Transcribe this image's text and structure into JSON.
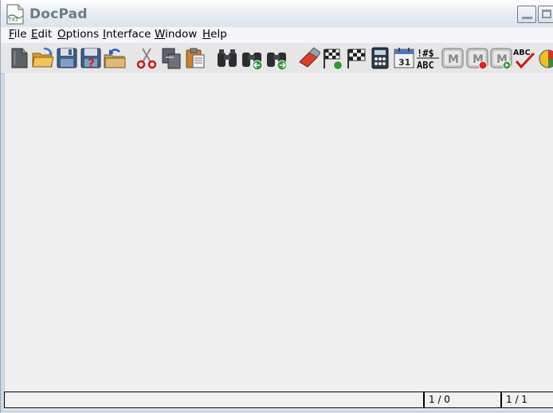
{
  "window": {
    "title": "DocPad"
  },
  "menu": [
    {
      "mnemonic": "F",
      "rest": "ile"
    },
    {
      "mnemonic": "E",
      "rest": "dit"
    },
    {
      "mnemonic": "O",
      "rest": "ptions"
    },
    {
      "mnemonic": "I",
      "rest": "nterface"
    },
    {
      "mnemonic": "W",
      "rest": "indow"
    },
    {
      "mnemonic": "H",
      "rest": "elp"
    }
  ],
  "toolbar": {
    "icons": [
      "new-document-icon",
      "open-folder-icon",
      "save-icon",
      "save-as-icon",
      "reload-icon",
      "cut-icon",
      "copy-icon",
      "paste-icon",
      "find-icon",
      "find-previous-icon",
      "find-next-icon",
      "eraser-icon",
      "goto-flag-icon",
      "finish-flag-icon",
      "calculator-icon",
      "calendar-icon",
      "character-map-icon",
      "macro-icon",
      "macro-record-icon",
      "macro-play-icon",
      "spellcheck-icon",
      "chart-icon"
    ],
    "calendar_day": "31",
    "charmap_top": "!#$",
    "charmap_bottom": "ABC",
    "spell_text": "ABC",
    "macro_letter": "M"
  },
  "status": {
    "message": "",
    "position": "1 / 0",
    "pages": "1 / 1"
  }
}
